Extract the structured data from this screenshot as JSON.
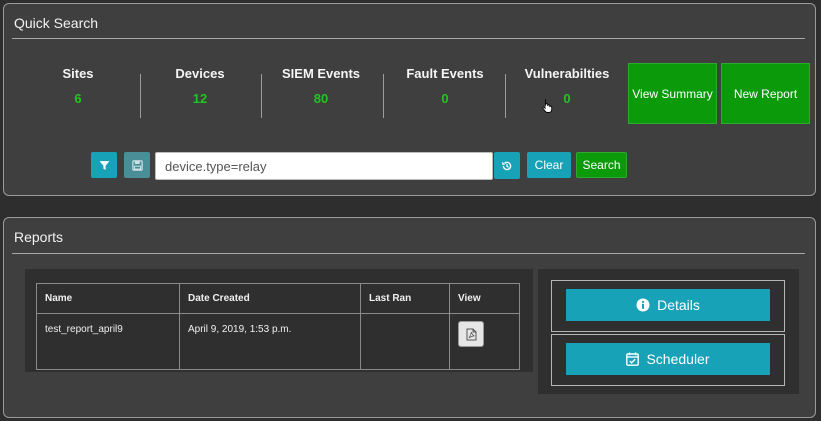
{
  "quick_search": {
    "title": "Quick Search",
    "stats": [
      {
        "label": "Sites",
        "value": "6"
      },
      {
        "label": "Devices",
        "value": "12"
      },
      {
        "label": "SIEM Events",
        "value": "80"
      },
      {
        "label": "Fault Events",
        "value": "0"
      },
      {
        "label": "Vulnerabilties",
        "value": "0"
      }
    ],
    "view_summary_label": "View Summary",
    "new_report_label": "New Report",
    "search_value": "device.type=relay",
    "clear_label": "Clear",
    "search_label": "Search"
  },
  "reports": {
    "title": "Reports",
    "columns": [
      "Name",
      "Date Created",
      "Last Ran",
      "View"
    ],
    "rows": [
      {
        "name": "test_report_april9",
        "date_created": "April 9, 2019, 1:53 p.m.",
        "last_ran": ""
      }
    ],
    "details_label": "Details",
    "scheduler_label": "Scheduler"
  },
  "colors": {
    "accent_teal": "#17a2b8",
    "accent_green": "#0a9a0a",
    "value_green": "#22c422"
  },
  "icons": [
    "filter-icon",
    "save-icon",
    "history-icon",
    "pdf-icon",
    "info-icon",
    "calendar-check-icon"
  ]
}
